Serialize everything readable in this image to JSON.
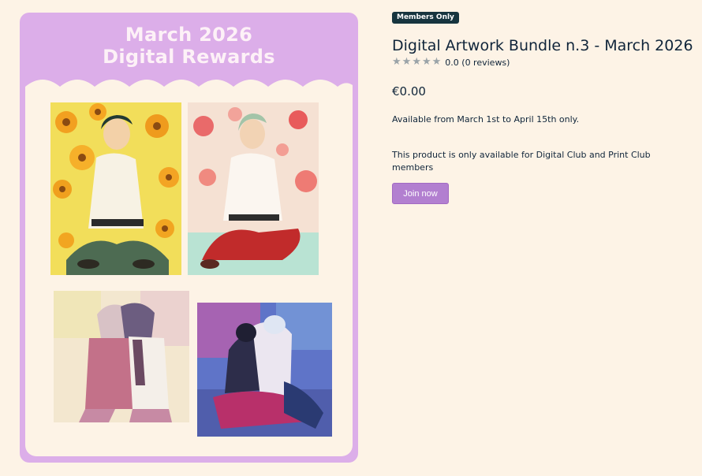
{
  "banner": {
    "line1": "March 2026",
    "line2": "Digital Rewards"
  },
  "artworks": [
    {
      "name": "sunflower-portrait"
    },
    {
      "name": "poppy-portrait"
    },
    {
      "name": "pink-sketch-kiss"
    },
    {
      "name": "blue-purple-embrace"
    }
  ],
  "product": {
    "badge": "Members Only",
    "title": "Digital Artwork Bundle n.3 - March 2026",
    "stars": [
      "★",
      "★",
      "★",
      "★",
      "★"
    ],
    "rating_text": "0.0 (0 reviews)",
    "price": "€0.00",
    "availability": "Available from March 1st to April 15th only.",
    "members_note": "This product is only available for Digital Club and Print Club members",
    "join_label": "Join now"
  },
  "colors": {
    "card": "#dcaee9",
    "background": "#fdf3e6",
    "badge": "#17353f",
    "button": "#b27fd0",
    "star": "#9aa3a8"
  }
}
